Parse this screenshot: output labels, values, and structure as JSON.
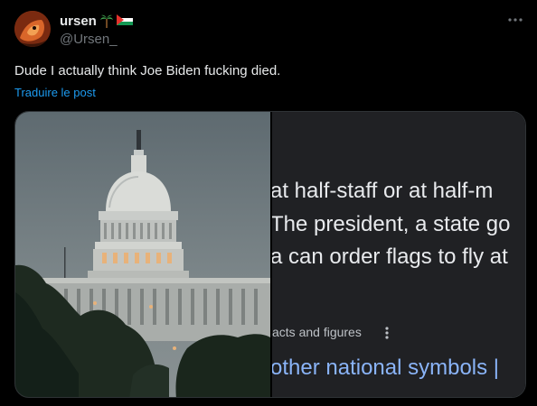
{
  "author": {
    "display_name": "ursen",
    "handle": "@Ursen_",
    "badges": [
      "palm-tree-emoji",
      "palestine-flag-emoji"
    ]
  },
  "menu": {
    "more_icon": "more-horizontal-icon"
  },
  "post": {
    "text": "Dude I actually think Joe Biden fucking died.",
    "translate_label": "Traduire le post"
  },
  "media": {
    "left_image": "us-capitol-building-photo",
    "right_image": {
      "lines": [
        "at half-staff or at half-m",
        "The president, a state go",
        "a can order flags to fly at"
      ],
      "facts_label": "acts and figures",
      "link_text": "other national symbols |"
    }
  },
  "colors": {
    "background": "#000000",
    "text_primary": "#e7e9ea",
    "text_secondary": "#71767b",
    "link_blue": "#1d9bf0",
    "google_dark_bg": "#202124",
    "google_link": "#8ab4f8"
  }
}
